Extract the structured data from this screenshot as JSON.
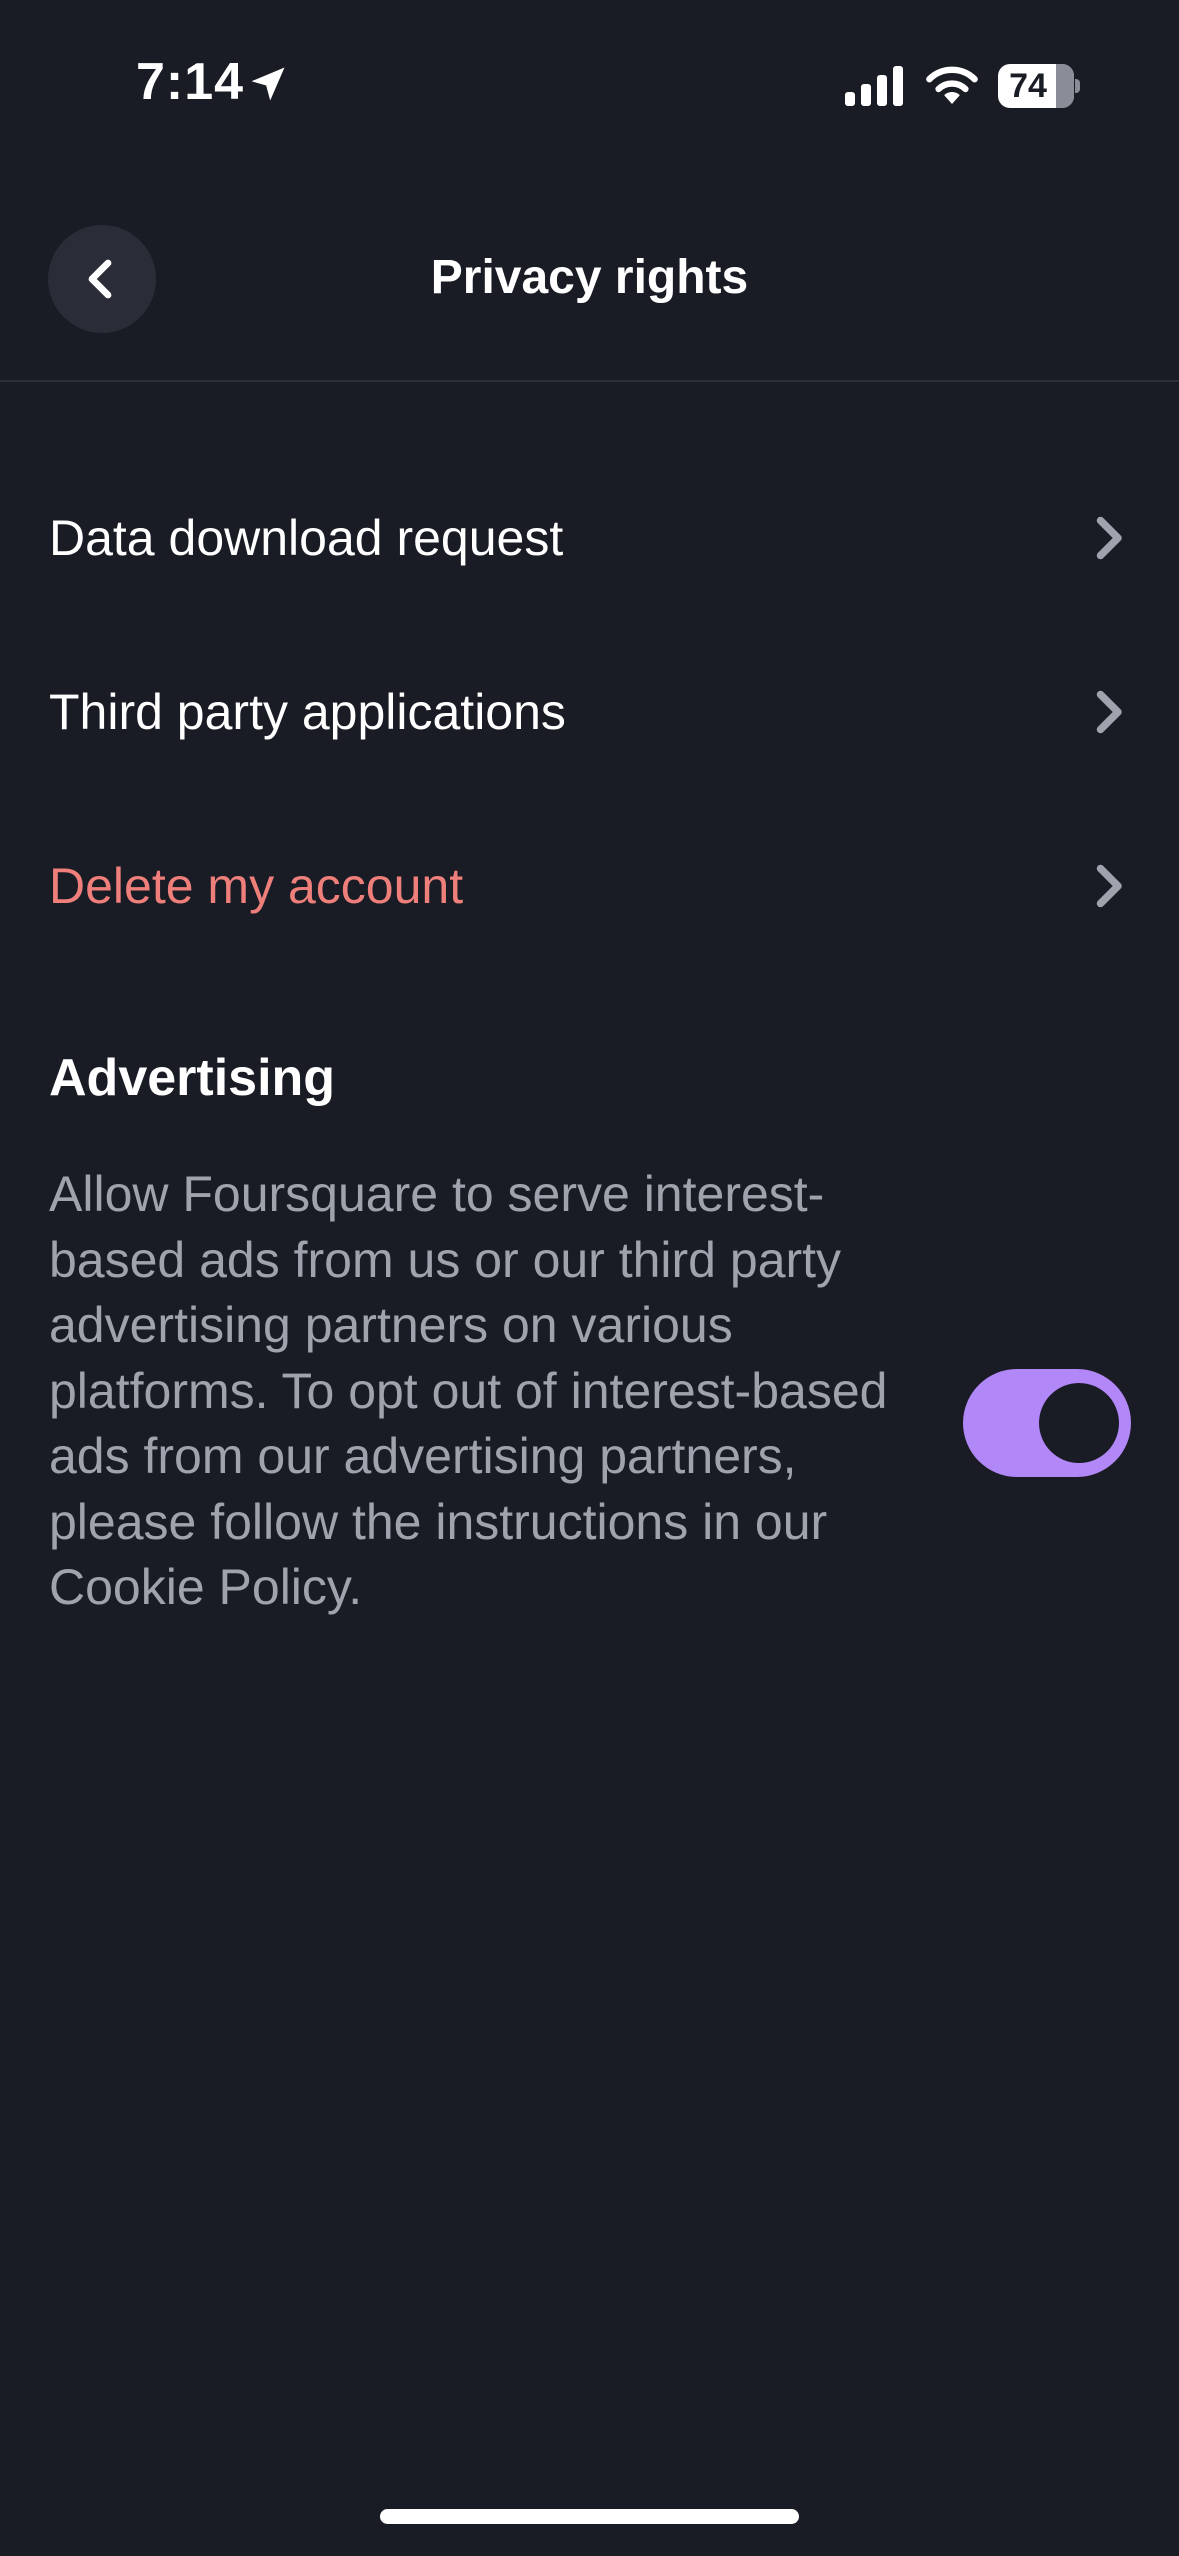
{
  "status_bar": {
    "time": "7:14",
    "battery_level": "74",
    "location_icon": "location-arrow-icon",
    "signal_icon": "cellular-signal-icon",
    "wifi_icon": "wifi-icon"
  },
  "header": {
    "title": "Privacy rights",
    "back_icon": "chevron-left-icon"
  },
  "menu": {
    "items": [
      {
        "label": "Data download request",
        "icon": "chevron-right-icon"
      },
      {
        "label": "Third party applications",
        "icon": "chevron-right-icon"
      },
      {
        "label": "Delete my account",
        "icon": "chevron-right-icon",
        "color": "#ef7f7b"
      }
    ]
  },
  "advertising": {
    "heading": "Advertising",
    "description": "Allow Foursquare to serve interest-based ads from us or our third party advertising partners on various platforms. To opt out of interest-based ads from our advertising partners, please follow the instructions in our Cookie Policy.",
    "toggle_on": true,
    "toggle_color": "#b287f8"
  },
  "colors": {
    "background": "#1a1c25",
    "danger": "#ef7f7b",
    "accent": "#b287f8"
  }
}
